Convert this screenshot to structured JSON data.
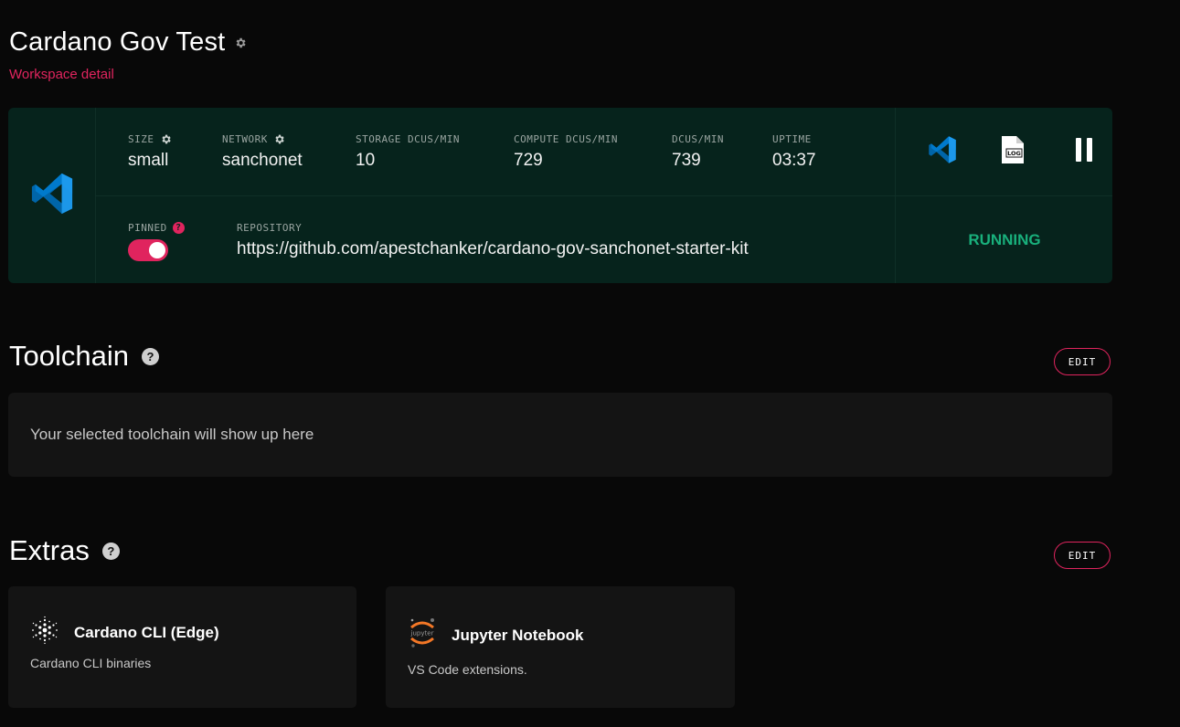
{
  "header": {
    "title": "Cardano Gov Test",
    "subtitle": "Workspace detail"
  },
  "workspace": {
    "icon": "vscode-icon",
    "stats": [
      {
        "label": "SIZE",
        "value": "small",
        "has_gear": true
      },
      {
        "label": "NETWORK",
        "value": "sanchonet",
        "has_gear": true
      },
      {
        "label": "STORAGE DCUS/MIN",
        "value": "10"
      },
      {
        "label": "COMPUTE DCUS/MIN",
        "value": "729"
      },
      {
        "label": "DCUS/MIN",
        "value": "739"
      },
      {
        "label": "UPTIME",
        "value": "03:37"
      }
    ],
    "pinned": {
      "label": "PINNED",
      "help": "?",
      "on": true
    },
    "repository": {
      "label": "REPOSITORY",
      "value": "https://github.com/apestchanker/cardano-gov-sanchonet-starter-kit"
    },
    "actions": {
      "vscode": "vscode-icon",
      "log": "LOG",
      "pause": "pause-icon"
    },
    "status": "RUNNING",
    "colors": {
      "accent": "#e0245e",
      "running": "#19b07c",
      "card_bg": "#06231c"
    }
  },
  "toolchain": {
    "title": "Toolchain",
    "help": "?",
    "edit_label": "EDIT",
    "empty_text": "Your selected toolchain will show up here"
  },
  "extras": {
    "title": "Extras",
    "help": "?",
    "edit_label": "EDIT",
    "items": [
      {
        "name": "Cardano CLI (Edge)",
        "description": "Cardano CLI binaries",
        "icon": "cardano-icon"
      },
      {
        "name": "Jupyter Notebook",
        "description": "VS Code extensions.",
        "icon": "jupyter-icon",
        "icon_text": "jupyter"
      }
    ]
  }
}
